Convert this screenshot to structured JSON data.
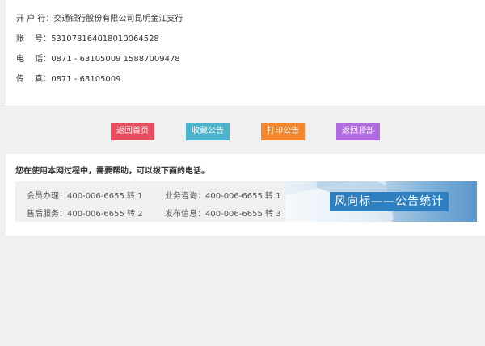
{
  "info": {
    "bank_label": "开 户 行：",
    "bank_value": "交通银行股份有限公司昆明金江支行",
    "account_label": "账　 号：",
    "account_value": "531078164018010064528",
    "phone_label": "电　 话：",
    "phone_value": "0871 - 63105009  15887009478",
    "fax_label": "传　 真：",
    "fax_value": "0871 - 63105009"
  },
  "buttons": {
    "home": "返回首页",
    "favorite": "收藏公告",
    "print": "打印公告",
    "top": "返回顶部"
  },
  "colors": {
    "home": "#e84c5e",
    "favorite": "#4bb3cc",
    "print": "#f5862c",
    "top": "#b16be1"
  },
  "help": {
    "title": "您在使用本网过程中，需要帮助，可以拨下面的电话。",
    "contacts": [
      "会员办理：400-006-6655 转 1",
      "业务咨询：400-006-6655 转 1",
      "售后服务：400-006-6655 转 2",
      "发布信息：400-006-6655 转 3"
    ]
  },
  "banner": {
    "text": "风向标——公告统计"
  }
}
